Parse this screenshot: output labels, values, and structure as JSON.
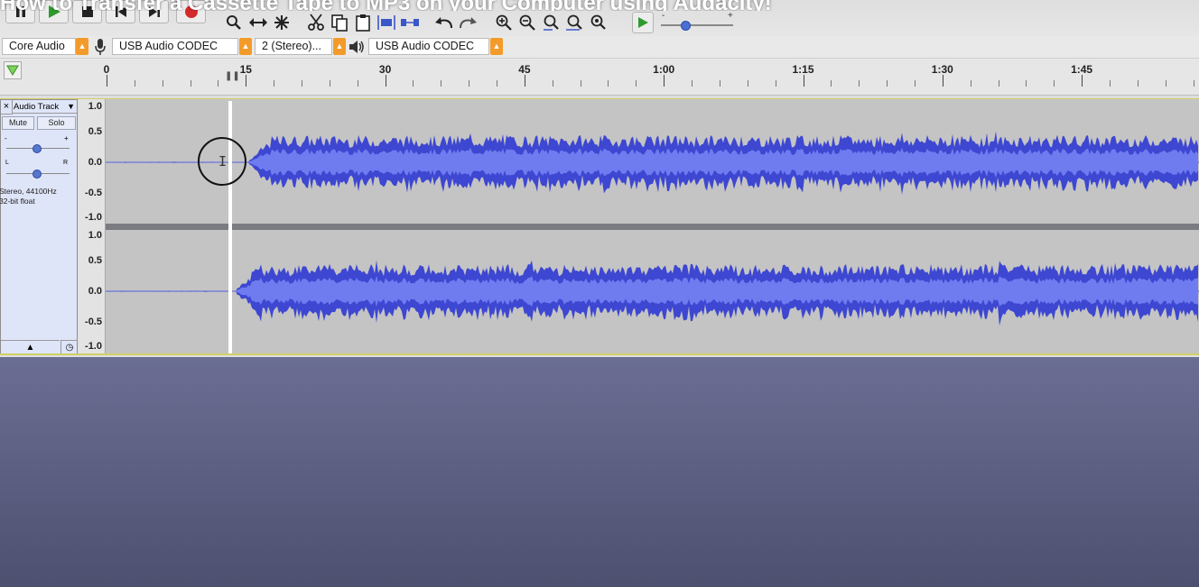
{
  "video_title": "How to Transfer a Cassette Tape to MP3 on your Computer using Audacity!",
  "toolbar": {
    "transport": [
      "pause-icon",
      "play-icon",
      "stop-icon",
      "skip-start-icon",
      "skip-end-icon",
      "record-icon"
    ],
    "tools": [
      "zoom-icon",
      "timeshift-icon",
      "multitool-icon"
    ],
    "edit": [
      "cut-icon",
      "copy-icon",
      "paste-icon",
      "trim-icon",
      "silence-icon",
      "undo-icon",
      "redo-icon"
    ],
    "zoom": [
      "zoom-in-icon",
      "zoom-out-icon",
      "fit-selection-icon",
      "fit-project-icon",
      "zoom-toggle-icon"
    ],
    "play_at_speed": "play-at-speed-icon",
    "speed_minus": "-",
    "speed_plus": "+"
  },
  "devices": {
    "host": "Core Audio",
    "recording_device": "USB Audio CODEC",
    "channels": "2 (Stereo)...",
    "playback_device": "USB Audio CODEC"
  },
  "ruler": {
    "labels": [
      "0",
      "15",
      "30",
      "45",
      "1:00",
      "1:15",
      "1:30",
      "1:45"
    ]
  },
  "track": {
    "name": "Audio Track",
    "mute": "Mute",
    "solo": "Solo",
    "gain_minus": "-",
    "gain_plus": "+",
    "pan_left": "L",
    "pan_right": "R",
    "info_rate": "Stereo, 44100Hz",
    "info_format": "32-bit float",
    "scale": [
      "1.0",
      "0.5",
      "0.0",
      "-0.5",
      "-1.0"
    ],
    "waveform_color": "#3d47d1",
    "waveform_rms_color": "#6f7cf0"
  },
  "colors": {
    "record": "#d42a2a",
    "play": "#2e9a2e",
    "dropdown_accent": "#f39b2a"
  }
}
